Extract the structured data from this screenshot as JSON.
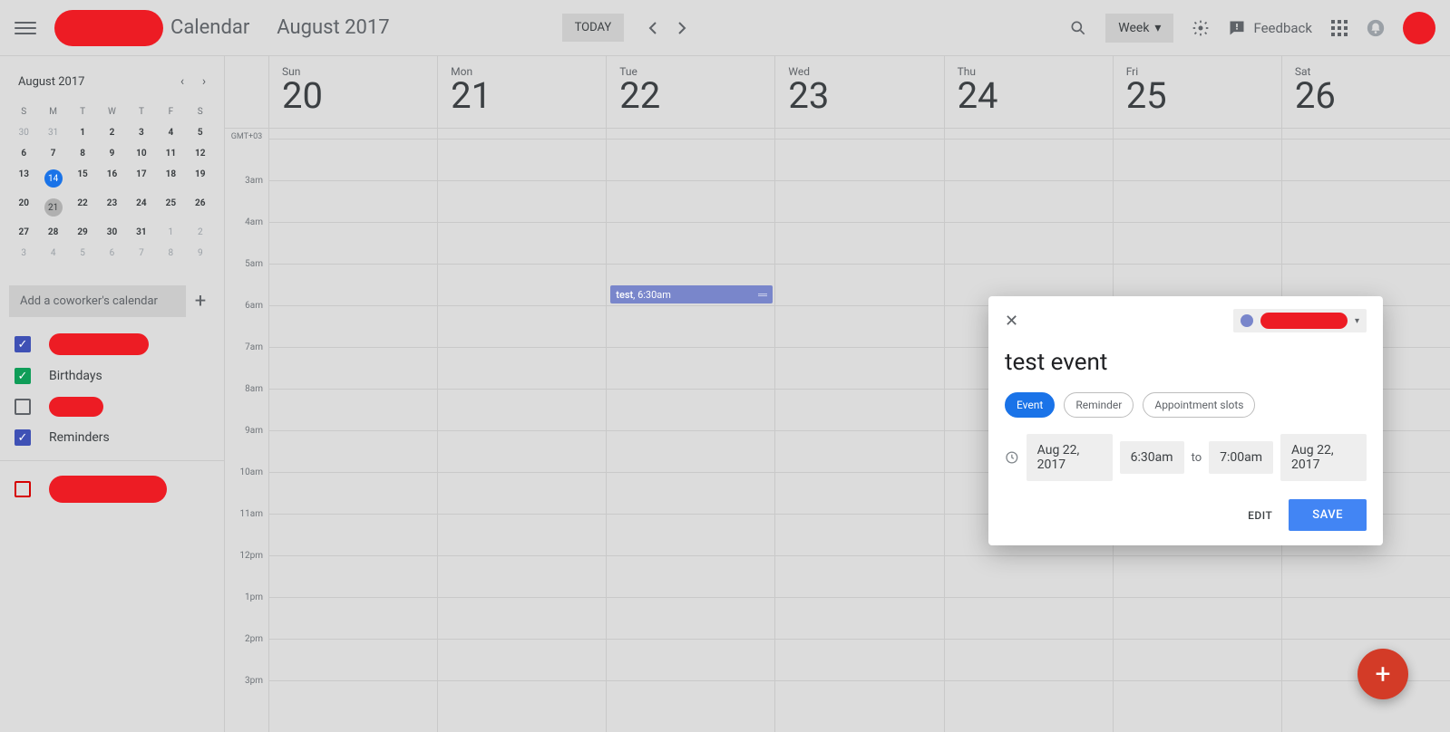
{
  "header": {
    "app_title": "Calendar",
    "month_title": "August 2017",
    "today_label": "TODAY",
    "view_label": "Week",
    "feedback_label": "Feedback"
  },
  "mini": {
    "title": "August 2017",
    "dow": [
      "S",
      "M",
      "T",
      "W",
      "T",
      "F",
      "S"
    ],
    "rows": [
      [
        {
          "n": "30",
          "muted": true
        },
        {
          "n": "31",
          "muted": true
        },
        {
          "n": "1",
          "bold": true
        },
        {
          "n": "2",
          "bold": true
        },
        {
          "n": "3",
          "bold": true
        },
        {
          "n": "4",
          "bold": true
        },
        {
          "n": "5",
          "bold": true
        }
      ],
      [
        {
          "n": "6",
          "bold": true
        },
        {
          "n": "7",
          "bold": true
        },
        {
          "n": "8",
          "bold": true
        },
        {
          "n": "9",
          "bold": true
        },
        {
          "n": "10",
          "bold": true
        },
        {
          "n": "11",
          "bold": true
        },
        {
          "n": "12",
          "bold": true
        }
      ],
      [
        {
          "n": "13",
          "bold": true
        },
        {
          "n": "14",
          "today": true
        },
        {
          "n": "15",
          "bold": true
        },
        {
          "n": "16",
          "bold": true
        },
        {
          "n": "17",
          "bold": true
        },
        {
          "n": "18",
          "bold": true
        },
        {
          "n": "19",
          "bold": true
        }
      ],
      [
        {
          "n": "20",
          "bold": true
        },
        {
          "n": "21",
          "sel": true
        },
        {
          "n": "22",
          "bold": true
        },
        {
          "n": "23",
          "bold": true
        },
        {
          "n": "24",
          "bold": true
        },
        {
          "n": "25",
          "bold": true
        },
        {
          "n": "26",
          "bold": true
        }
      ],
      [
        {
          "n": "27",
          "bold": true
        },
        {
          "n": "28",
          "bold": true
        },
        {
          "n": "29",
          "bold": true
        },
        {
          "n": "30",
          "bold": true
        },
        {
          "n": "31",
          "bold": true
        },
        {
          "n": "1",
          "muted": true
        },
        {
          "n": "2",
          "muted": true
        }
      ],
      [
        {
          "n": "3",
          "muted": true
        },
        {
          "n": "4",
          "muted": true
        },
        {
          "n": "5",
          "muted": true
        },
        {
          "n": "6",
          "muted": true
        },
        {
          "n": "7",
          "muted": true
        },
        {
          "n": "8",
          "muted": true
        },
        {
          "n": "9",
          "muted": true
        }
      ]
    ]
  },
  "coworker_placeholder": "Add a coworker's calendar",
  "calendars": {
    "item1_label": "",
    "item2_label": "Birthdays",
    "item3_label": "",
    "item4_label": "Reminders",
    "item5_label": ""
  },
  "week": {
    "tz": "GMT+03",
    "days": [
      {
        "dow": "Sun",
        "num": "20"
      },
      {
        "dow": "Mon",
        "num": "21"
      },
      {
        "dow": "Tue",
        "num": "22"
      },
      {
        "dow": "Wed",
        "num": "23"
      },
      {
        "dow": "Thu",
        "num": "24"
      },
      {
        "dow": "Fri",
        "num": "25"
      },
      {
        "dow": "Sat",
        "num": "26"
      }
    ],
    "hours": [
      "",
      "3am",
      "4am",
      "5am",
      "6am",
      "7am",
      "8am",
      "9am",
      "10am",
      "11am",
      "12pm",
      "1pm",
      "2pm",
      "3pm"
    ]
  },
  "event_chip": {
    "title": "test",
    "time": "6:30am"
  },
  "popup": {
    "title_value": "test event",
    "chip_event": "Event",
    "chip_reminder": "Reminder",
    "chip_slots": "Appointment slots",
    "date_start": "Aug 22, 2017",
    "time_start": "6:30am",
    "to": "to",
    "time_end": "7:00am",
    "date_end": "Aug 22, 2017",
    "edit": "EDIT",
    "save": "SAVE"
  }
}
